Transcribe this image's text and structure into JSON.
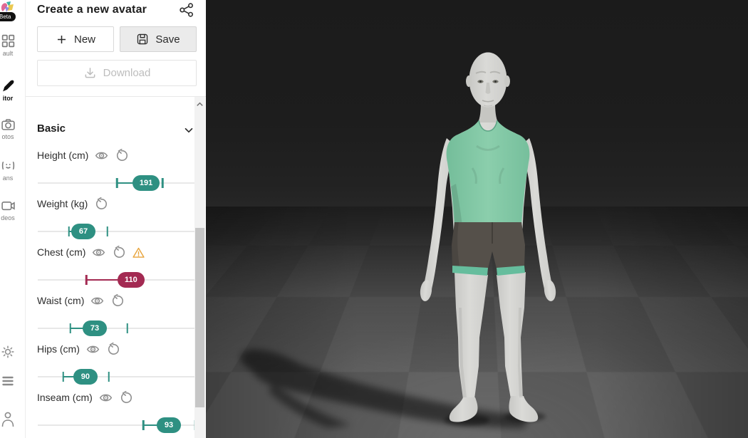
{
  "app": {
    "beta_badge": "Beta"
  },
  "sidebar": {
    "items": [
      {
        "id": "vault",
        "label": "ault",
        "active": false
      },
      {
        "id": "editor",
        "label": "itor",
        "active": true
      },
      {
        "id": "photos",
        "label": "otos",
        "active": false
      },
      {
        "id": "scans",
        "label": "ans",
        "active": false
      },
      {
        "id": "videos",
        "label": "deos",
        "active": false
      }
    ],
    "footer_icons": [
      "brightness",
      "list",
      "account"
    ]
  },
  "header": {
    "title": "Create a new avatar",
    "new_label": "New",
    "save_label": "Save",
    "download_label": "Download"
  },
  "panel": {
    "section_title": "Basic",
    "sliders": [
      {
        "label": "Height (cm)",
        "value": "191",
        "color": "#2E9082",
        "has_eye": true,
        "has_reset": true,
        "warning": false,
        "left_pct": 49.8,
        "pill_pct": 68.2,
        "right_pct": 78.5
      },
      {
        "label": "Weight (kg)",
        "value": "67",
        "color": "#2E9082",
        "has_eye": false,
        "has_reset": true,
        "warning": false,
        "left_pct": 19.7,
        "pill_pct": 28.7,
        "right_pct": 43.9
      },
      {
        "label": "Chest (cm)",
        "value": "110",
        "color": "#A32A52",
        "has_eye": true,
        "has_reset": true,
        "warning": true,
        "left_pct": 30.5,
        "pill_pct": 58.7,
        "right_pct": null
      },
      {
        "label": "Waist (cm)",
        "value": "73",
        "color": "#2E9082",
        "has_eye": true,
        "has_reset": true,
        "warning": false,
        "left_pct": 20.6,
        "pill_pct": 35.9,
        "right_pct": 56.5
      },
      {
        "label": "Hips (cm)",
        "value": "90",
        "color": "#2E9082",
        "has_eye": true,
        "has_reset": true,
        "warning": false,
        "left_pct": 16.1,
        "pill_pct": 30.0,
        "right_pct": 44.8
      },
      {
        "label": "Inseam (cm)",
        "value": "93",
        "color": "#2E9082",
        "has_eye": true,
        "has_reset": true,
        "warning": false,
        "left_pct": 66.4,
        "pill_pct": 82.5,
        "right_pct": 99.1
      }
    ]
  },
  "viewport": {
    "scene": "dark studio with grey checkerboard floor",
    "avatar": {
      "skin_color": "#D5D4D1",
      "shirt_color": "#7FC6A4",
      "shorts_color": "#55504A",
      "trim_color": "#66BD9D"
    }
  },
  "colors": {
    "teal": "#2E9082",
    "crimson": "#A32A52",
    "warning": "#E8A43C",
    "track": "#E8E8E8"
  }
}
